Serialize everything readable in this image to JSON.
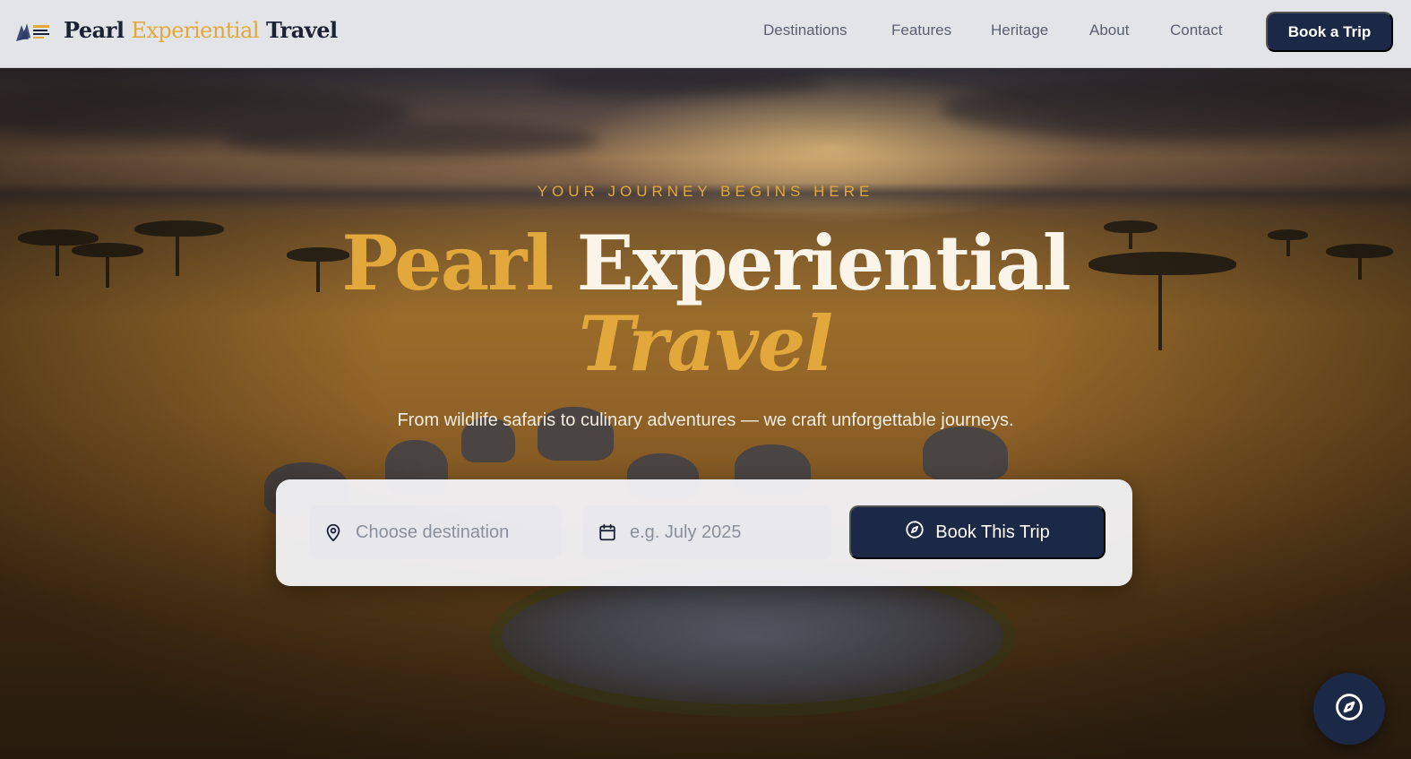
{
  "header": {
    "brand": {
      "part1": "Pearl",
      "part2": "Experiential",
      "part3": "Travel"
    },
    "nav": [
      {
        "label": "Destinations"
      },
      {
        "label": "Features"
      },
      {
        "label": "Heritage"
      },
      {
        "label": "About"
      },
      {
        "label": "Contact"
      }
    ],
    "cta_label": "Book a Trip"
  },
  "hero": {
    "eyebrow": "YOUR JOURNEY BEGINS HERE",
    "title_gold": "Pearl",
    "title_white": "Experiential",
    "title_line2": "Travel",
    "subtitle": "From wildlife safaris to culinary adventures — we craft unforgettable journeys."
  },
  "booking": {
    "destination": {
      "value": "",
      "placeholder": "Choose destination",
      "icon": "map-pin-icon"
    },
    "date": {
      "value": "",
      "placeholder": "e.g. July 2025",
      "icon": "calendar-icon"
    },
    "submit_label": "Book This Trip",
    "submit_icon": "compass-icon"
  },
  "fab": {
    "icon": "compass-icon"
  },
  "colors": {
    "navy": "#1b2846",
    "gold": "#e2a83c",
    "header_bg": "#e3e4e8"
  }
}
